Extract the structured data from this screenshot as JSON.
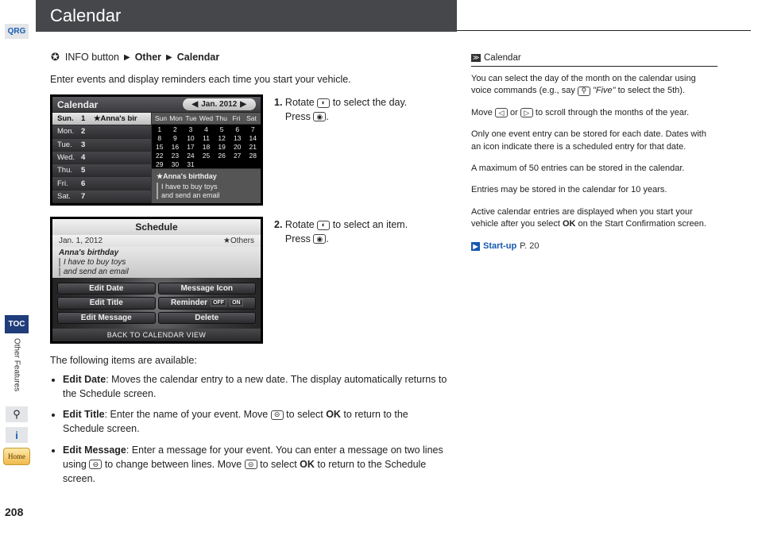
{
  "title": "Calendar",
  "sidebar": {
    "qrg": "QRG",
    "toc": "TOC",
    "section": "Other Features",
    "home": "Home",
    "page": "208"
  },
  "breadcrumb": {
    "info": "INFO button",
    "other": "Other",
    "calendar": "Calendar"
  },
  "intro": "Enter events and display reminders each time you start your vehicle.",
  "shot1": {
    "title": "Calendar",
    "month": "Jan. 2012",
    "days": [
      {
        "day": "Sun.",
        "num": "1",
        "extra": "★Anna's bir",
        "active": true
      },
      {
        "day": "Mon.",
        "num": "2"
      },
      {
        "day": "Tue.",
        "num": "3"
      },
      {
        "day": "Wed.",
        "num": "4"
      },
      {
        "day": "Thu.",
        "num": "5"
      },
      {
        "day": "Fri.",
        "num": "6"
      },
      {
        "day": "Sat.",
        "num": "7"
      }
    ],
    "grid_head": [
      "Sun",
      "Mon",
      "Tue",
      "Wed",
      "Thu",
      "Fri",
      "Sat"
    ],
    "grid": [
      [
        "1",
        "2",
        "3",
        "4",
        "5",
        "6",
        "7"
      ],
      [
        "8",
        "9",
        "10",
        "11",
        "12",
        "13",
        "14"
      ],
      [
        "15",
        "16",
        "17",
        "18",
        "19",
        "20",
        "21"
      ],
      [
        "22",
        "23",
        "24",
        "25",
        "26",
        "27",
        "28"
      ],
      [
        "29",
        "30",
        "31",
        "",
        "",
        "",
        ""
      ]
    ],
    "preview": {
      "title": "★Anna's birthday",
      "l1": "I have to buy toys",
      "l2": "and send an email"
    }
  },
  "shot2": {
    "head": "Schedule",
    "date": "Jan. 1, 2012",
    "others": "★Others",
    "title_line": "Anna's birthday",
    "body1": "I have to buy toys",
    "body2": "and send an email",
    "b1": "Edit Date",
    "b2": "Message Icon",
    "b3": "Edit Title",
    "b4_label": "Reminder",
    "b4_off": "OFF",
    "b4_on": "ON",
    "b5": "Edit Message",
    "b6": "Delete",
    "foot": "BACK TO CALENDAR VIEW"
  },
  "steps": {
    "s1a": "1.",
    "s1b": " Rotate ",
    "s1c": " to select the day.",
    "s1d": "Press ",
    "s1e": ".",
    "s2a": "2.",
    "s2b": " Rotate ",
    "s2c": " to select an item.",
    "s2d": "Press ",
    "s2e": "."
  },
  "items_intro": "The following items are available:",
  "items": [
    {
      "h": "Edit Date",
      "t": ": Moves the calendar entry to a new date. The display automatically returns to the Schedule screen."
    },
    {
      "h": "Edit Title",
      "t_a": ": Enter the name of your event. Move ",
      "t_b": " to select ",
      "ok": "OK",
      "t_c": " to return to the Schedule screen."
    },
    {
      "h": "Edit Message",
      "t_a": ": Enter a message for your event. You can enter a message on two lines using ",
      "t_b": " to change between lines. Move ",
      "t_c": " to select ",
      "ok": "OK",
      "t_d": " to return to the Schedule screen."
    }
  ],
  "side": {
    "head": "Calendar",
    "p1a": "You can select the day of the month on the calendar using voice commands (e.g., say ",
    "p1b": "\"Five\"",
    "p1c": " to select the 5th).",
    "p2a": "Move ",
    "p2b": " or ",
    "p2c": " to scroll through the months of the year.",
    "p3": "Only one event entry can be stored for each date. Dates with an icon indicate there is a scheduled entry for that date.",
    "p4": "A maximum of 50 entries can be stored in the calendar.",
    "p5": "Entries may be stored in the calendar for 10 years.",
    "p6a": "Active calendar entries are displayed when you start your vehicle after you select ",
    "p6ok": "OK",
    "p6b": " on the Start Confirmation screen.",
    "link": "Start-up",
    "link_page": "P. 20"
  }
}
